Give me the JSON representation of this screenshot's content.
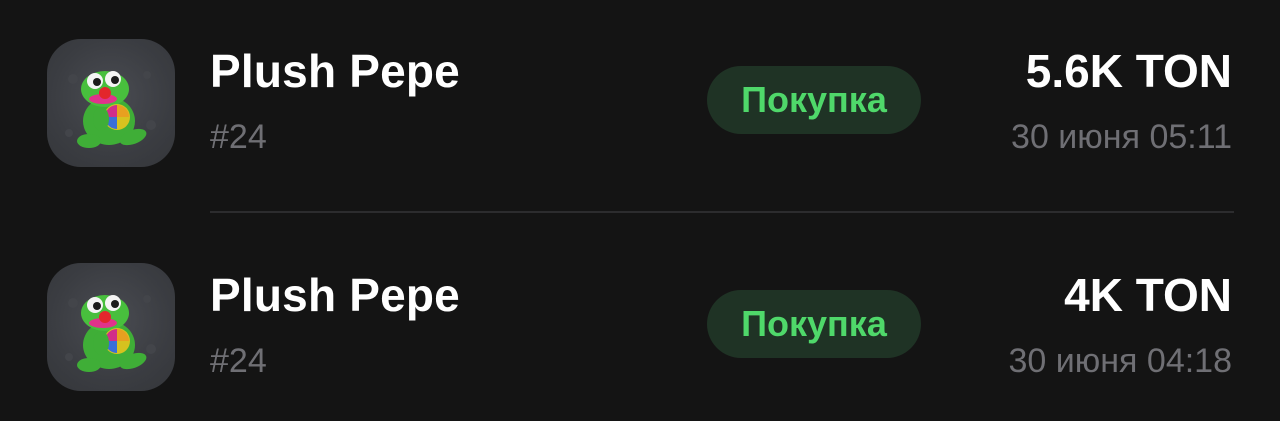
{
  "items": [
    {
      "title": "Plush Pepe",
      "number": "#24",
      "badge": "Покупка",
      "price": "5.6K TON",
      "date": "30 июня 05:11",
      "icon": "plush-pepe-icon"
    },
    {
      "title": "Plush Pepe",
      "number": "#24",
      "badge": "Покупка",
      "price": "4K TON",
      "date": "30 июня 04:18",
      "icon": "plush-pepe-icon"
    }
  ],
  "colors": {
    "background": "#141414",
    "badge_bg": "#1f3325",
    "badge_text": "#4fd86a",
    "secondary_text": "#6f6f74",
    "primary_text": "#ffffff"
  }
}
